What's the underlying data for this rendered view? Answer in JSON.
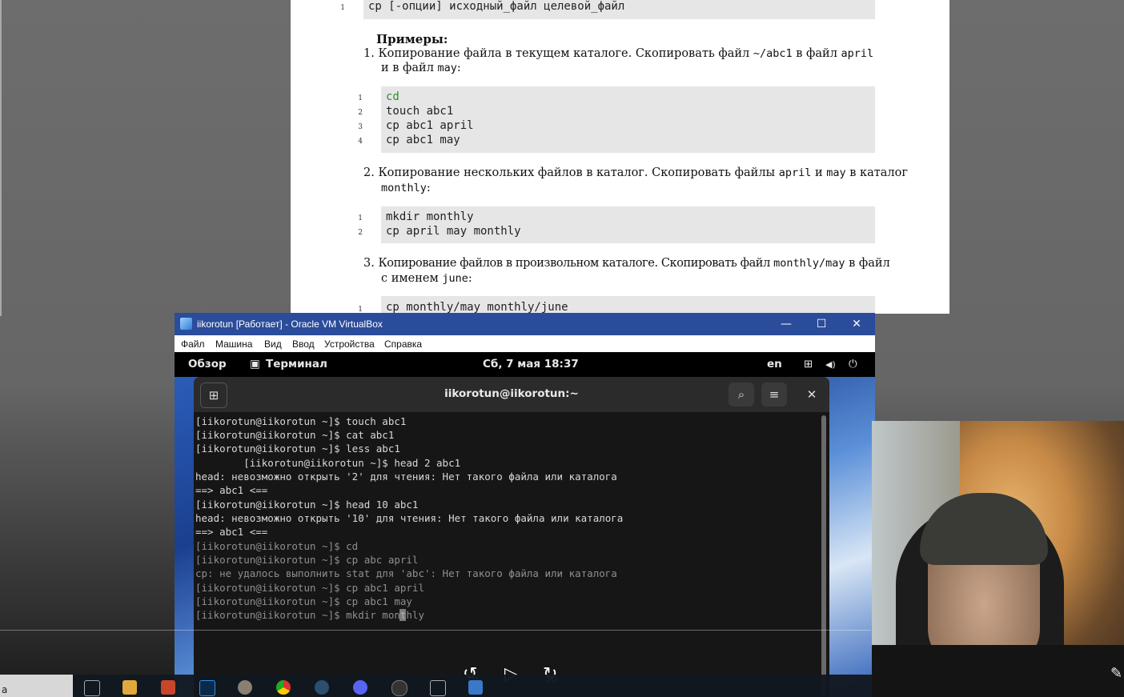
{
  "pdf": {
    "syntax_line_number": "1",
    "syntax": "cp [-опции] исходный_файл целевой_файл",
    "examples_heading": "Примеры:",
    "items": [
      {
        "number": "1.",
        "line1": "Копирование файла в текущем каталоге. Скопировать файл ",
        "code1": "~/abc1",
        "line1b": " в файл ",
        "code2": "april",
        "line2": "и в файл ",
        "code3": "may",
        "line2b": ":",
        "code_lines": [
          {
            "n": "1",
            "text": "cd"
          },
          {
            "n": "2",
            "text": "touch abc1"
          },
          {
            "n": "3",
            "text": "cp abc1 april"
          },
          {
            "n": "4",
            "text": "cp abc1 may"
          }
        ]
      },
      {
        "number": "2.",
        "line1": "Копирование нескольких файлов в каталог. Скопировать файлы ",
        "code1": "april",
        "line1b": " и ",
        "code2": "may",
        "line1c": " в каталог",
        "line2code": "monthly",
        "line2b": ":",
        "code_lines": [
          {
            "n": "1",
            "text": "mkdir monthly"
          },
          {
            "n": "2",
            "text": "cp april may monthly"
          }
        ]
      },
      {
        "number": "3.",
        "line1": "Копирование файлов в произвольном каталоге. Скопировать файл ",
        "code1": "monthly/may",
        "line1b": " в файл",
        "line2": "с именем ",
        "code2": "june",
        "line2b": ":",
        "code_lines": [
          {
            "n": "1",
            "text": "cp monthly/may monthly/june"
          }
        ]
      }
    ]
  },
  "vbox": {
    "title": "iikorotun [Работает] - Oracle VM VirtualBox",
    "menu": [
      "Файл",
      "Машина",
      "Вид",
      "Ввод",
      "Устройства",
      "Справка"
    ],
    "minimize": "—",
    "maximize": "☐",
    "close": "✕"
  },
  "gnome": {
    "activities": "Обзор",
    "app_icon": "▣",
    "app": "Терминал",
    "clock": "Сб, 7 мая  18:37",
    "lang": "en",
    "network_icon": "⊞",
    "volume_icon": "◀)",
    "power_icon": "⏻"
  },
  "terminal": {
    "title": "iikorotun@iikorotun:~",
    "new_tab_icon": "⊞",
    "search_icon": "⌕",
    "menu_icon": "≡",
    "close_icon": "✕",
    "lines": [
      "[iikorotun@iikorotun ~]$ touch abc1",
      "[iikorotun@iikorotun ~]$ cat abc1",
      "[iikorotun@iikorotun ~]$ less abc1",
      "        [iikorotun@iikorotun ~]$ head 2 abc1",
      "head: невозможно открыть '2' для чтения: Нет такого файла или каталога",
      "==> abc1 <==",
      "[iikorotun@iikorotun ~]$ head 10 abc1",
      "head: невозможно открыть '10' для чтения: Нет такого файла или каталога",
      "==> abc1 <==",
      "[iikorotun@iikorotun ~]$ cd",
      "[iikorotun@iikorotun ~]$ cp abc april",
      "cp: не удалось выполнить stat для 'abc': Нет такого файла или каталога",
      "[iikorotun@iikorotun ~]$ cp abc1 april",
      "[iikorotun@iikorotun ~]$ cp abc1 may",
      "[iikorotun@iikorotun ~]$ mkdir monthly"
    ]
  },
  "video": {
    "rewind_label": "10",
    "forward_label": "30",
    "rewind_icon": "↺",
    "play_icon": "▷",
    "forward_icon": "↻"
  },
  "taskbar": {
    "search_text": "a"
  },
  "colors": {
    "vbox_title": "#2b4c9a",
    "code_green": "#2e8b2e",
    "code_bg": "#e6e6e6"
  }
}
